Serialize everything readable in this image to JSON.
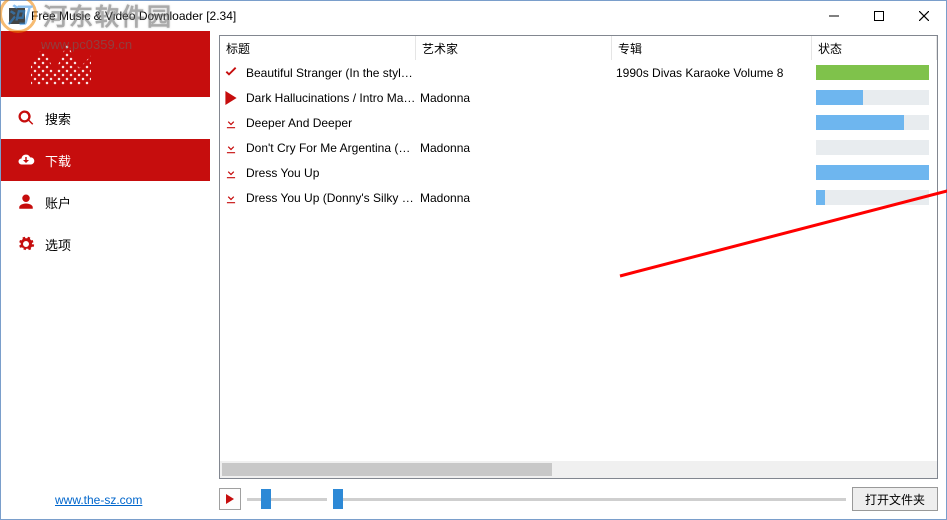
{
  "window": {
    "title": "Free Music & Video Downloader [2.34]"
  },
  "watermark": {
    "logo_text": "河",
    "text": "河东软件园",
    "url": "www.pc0359.cn"
  },
  "sidebar": {
    "items": [
      {
        "key": "search",
        "label": "搜索",
        "active": false
      },
      {
        "key": "download",
        "label": "下载",
        "active": true
      },
      {
        "key": "account",
        "label": "账户",
        "active": false
      },
      {
        "key": "options",
        "label": "选项",
        "active": false
      }
    ],
    "footer_link": "www.the-sz.com"
  },
  "list": {
    "headers": {
      "title": "标题",
      "artist": "艺术家",
      "album": "专辑",
      "state": "状态"
    },
    "rows": [
      {
        "icon": "check",
        "title": "Beautiful Stranger (In the style of ...",
        "artist": "",
        "album": "1990s Divas Karaoke Volume 8",
        "progress": 100,
        "color": "green"
      },
      {
        "icon": "play",
        "title": "Dark Hallucinations / Intro Mado...",
        "artist": "Madonna",
        "album": "",
        "progress": 42,
        "color": "blue"
      },
      {
        "icon": "download",
        "title": "Deeper And Deeper",
        "artist": "",
        "album": "",
        "progress": 78,
        "color": "blue"
      },
      {
        "icon": "download",
        "title": "Don't Cry For Me Argentina (The ...",
        "artist": "Madonna",
        "album": "",
        "progress": 0,
        "color": "blue"
      },
      {
        "icon": "download",
        "title": "Dress You Up",
        "artist": "",
        "album": "",
        "progress": 100,
        "color": "blue"
      },
      {
        "icon": "download",
        "title": "Dress You Up (Donny's Silky Sm...",
        "artist": "Madonna",
        "album": "",
        "progress": 8,
        "color": "blue"
      }
    ]
  },
  "bottom": {
    "open_folder": "打开文件夹",
    "volume_pct": 18,
    "seek_pct": 0
  }
}
